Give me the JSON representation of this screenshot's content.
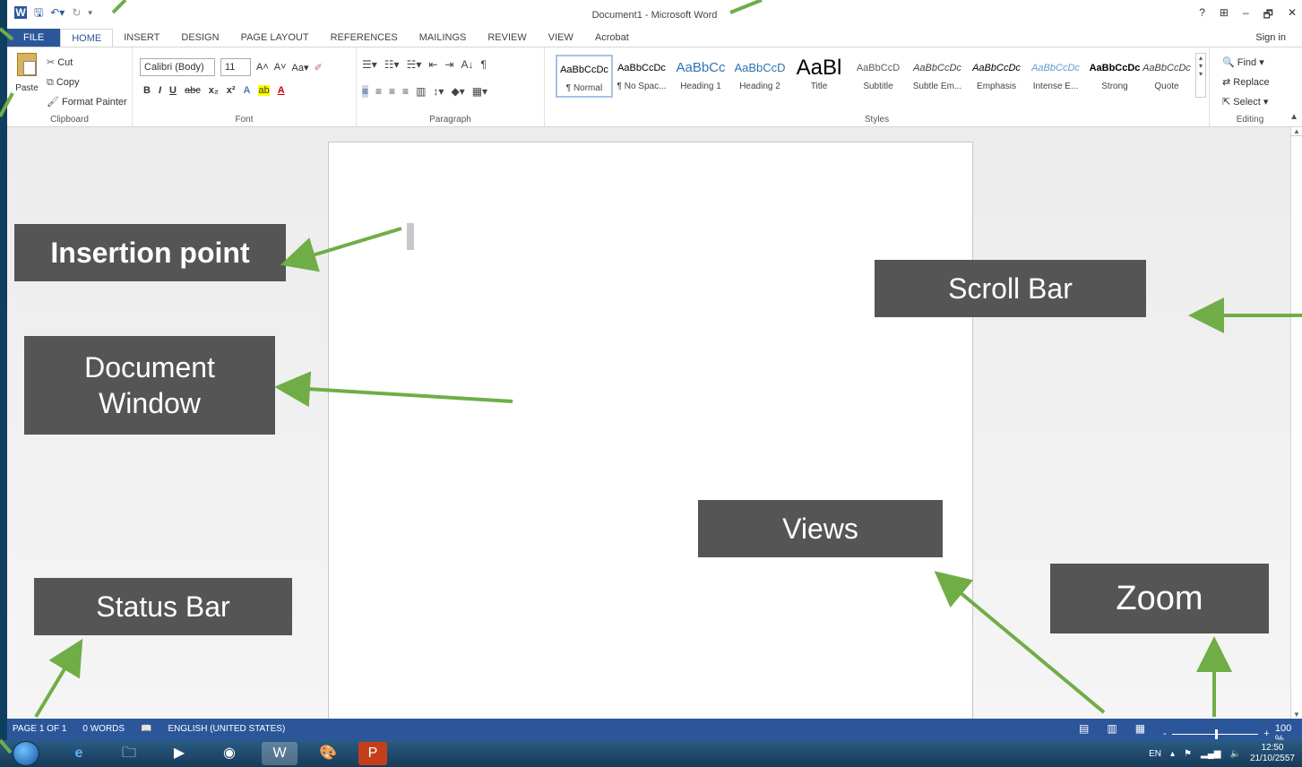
{
  "window": {
    "title": "Document1 - Microsoft Word",
    "qat": {
      "word_logo": "W",
      "save_icon": "save-icon",
      "undo_icon": "undo-icon",
      "redo_icon": "redo-icon"
    },
    "controls": [
      "?",
      "⊞",
      "–",
      "🗗",
      "✕"
    ]
  },
  "tabs": {
    "file": "FILE",
    "items": [
      "HOME",
      "INSERT",
      "DESIGN",
      "PAGE LAYOUT",
      "REFERENCES",
      "MAILINGS",
      "REVIEW",
      "VIEW",
      "Acrobat"
    ],
    "active": "HOME",
    "sign_in": "Sign in"
  },
  "ribbon": {
    "clipboard": {
      "label": "Clipboard",
      "paste": "Paste",
      "cut": "Cut",
      "copy": "Copy",
      "format_painter": "Format Painter"
    },
    "font": {
      "label": "Font",
      "font_name": "Calibri (Body)",
      "font_size": "11",
      "grow": "A˄",
      "shrink": "A˅",
      "case": "Aa▾",
      "bold": "B",
      "italic": "I",
      "underline": "U",
      "strike": "abc",
      "subscript": "x₂",
      "superscript": "x²",
      "effects": "A",
      "highlight": "ab",
      "color": "A"
    },
    "paragraph": {
      "label": "Paragraph",
      "row1": [
        "☰▾",
        "☷▾",
        "☵▾",
        "⇤",
        "⇥",
        "A↓",
        "¶"
      ],
      "row2": [
        "≡",
        "≡",
        "≡",
        "≡",
        "▥",
        "↕▾",
        "◆▾",
        "▦▾"
      ]
    },
    "styles": {
      "label": "Styles",
      "items": [
        {
          "preview": "AaBbCcDc",
          "name": "¶ Normal"
        },
        {
          "preview": "AaBbCcDc",
          "name": "¶ No Spac..."
        },
        {
          "preview": "AaBbCc",
          "name": "Heading 1"
        },
        {
          "preview": "AaBbCcD",
          "name": "Heading 2"
        },
        {
          "preview": "AaBl",
          "name": "Title"
        },
        {
          "preview": "AaBbCcD",
          "name": "Subtitle"
        },
        {
          "preview": "AaBbCcDc",
          "name": "Subtle Em..."
        },
        {
          "preview": "AaBbCcDc",
          "name": "Emphasis"
        },
        {
          "preview": "AaBbCcDc",
          "name": "Intense E..."
        },
        {
          "preview": "AaBbCcDc",
          "name": "Strong"
        },
        {
          "preview": "AaBbCcDc",
          "name": "Quote"
        }
      ]
    },
    "editing": {
      "label": "Editing",
      "find": "Find",
      "replace": "Replace",
      "select": "Select"
    }
  },
  "statusbar": {
    "page": "PAGE 1 OF 1",
    "words": "0 WORDS",
    "language": "ENGLISH (UNITED STATES)",
    "zoom": "100 %",
    "zoom_minus": "-",
    "zoom_plus": "+"
  },
  "taskbar": {
    "tray_lang": "EN",
    "time": "12:50",
    "date": "21/10/2557"
  },
  "callouts": {
    "insertion_point": "Insertion point",
    "document_window": "Document Window",
    "scroll_bar": "Scroll Bar",
    "views": "Views",
    "status_bar": "Status Bar",
    "zoom": "Zoom"
  },
  "colors": {
    "accent": "#2b579a",
    "callout_bg": "#555555",
    "arrow": "#70ad47",
    "desktop": "#0e3f5f"
  }
}
